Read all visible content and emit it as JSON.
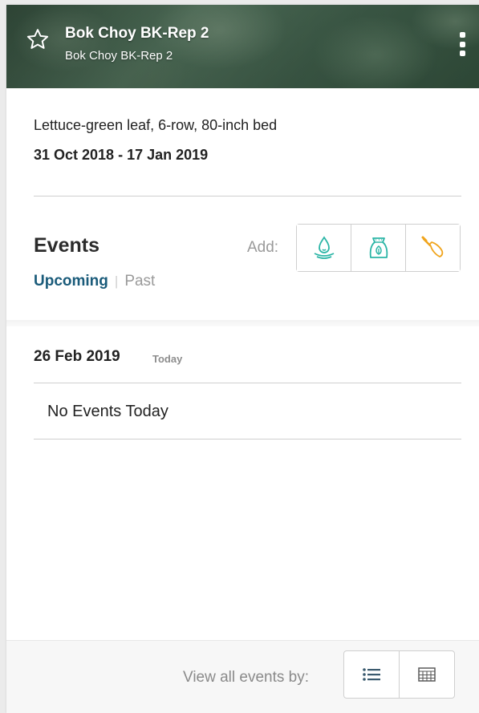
{
  "header": {
    "title": "Bok Choy BK-Rep 2",
    "subtitle": "Bok Choy BK-Rep 2"
  },
  "details": {
    "crop_description": "Lettuce-green leaf, 6-row, 80-inch bed",
    "date_range": "31 Oct 2018 - 17 Jan 2019"
  },
  "events": {
    "title": "Events",
    "add_label": "Add:",
    "add_buttons": [
      {
        "icon": "water-drop-icon",
        "color": "#2bb5a6"
      },
      {
        "icon": "fertilizer-bag-icon",
        "color": "#2bb5a6"
      },
      {
        "icon": "trowel-icon",
        "color": "#f0a41c"
      }
    ],
    "tabs": {
      "upcoming": "Upcoming",
      "past": "Past"
    },
    "day": {
      "date": "26 Feb 2019",
      "badge": "Today",
      "empty_message": "No Events Today"
    }
  },
  "footer": {
    "view_label": "View all events by:",
    "view_buttons": [
      "list-icon",
      "calendar-grid-icon"
    ]
  },
  "colors": {
    "accent_teal": "#2bb5a6",
    "accent_orange": "#f0a41c",
    "tab_active": "#1a5b7a"
  }
}
